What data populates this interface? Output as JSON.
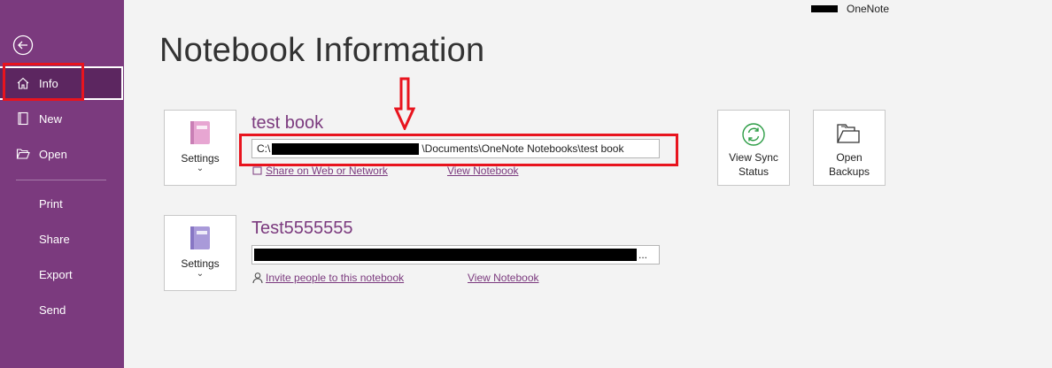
{
  "app": {
    "name": "OneNote"
  },
  "sidebar": {
    "back_icon": "back-arrow-icon",
    "items": [
      {
        "label": "Info",
        "icon": "home-icon"
      },
      {
        "label": "New",
        "icon": "new-notebook-icon"
      },
      {
        "label": "Open",
        "icon": "folder-open-icon"
      },
      {
        "label": "Print"
      },
      {
        "label": "Share"
      },
      {
        "label": "Export"
      },
      {
        "label": "Send"
      }
    ]
  },
  "page": {
    "title": "Notebook Information"
  },
  "notebooks": [
    {
      "name": "test book",
      "settings_label": "Settings",
      "path_prefix": "C:\\",
      "path_suffix": "\\Documents\\OneNote Notebooks\\test book",
      "share_link": "Share on Web or Network",
      "view_link": "View Notebook"
    },
    {
      "name": "Test5555555",
      "settings_label": "Settings",
      "path_suffix": "...",
      "share_link": "Invite people to this notebook",
      "view_link": "View Notebook"
    }
  ],
  "actions": {
    "sync_label_1": "View Sync",
    "sync_label_2": "Status",
    "backups_label_1": "Open",
    "backups_label_2": "Backups"
  },
  "colors": {
    "sidebar": "#7b3a7e",
    "accent": "#7b3a7e",
    "annotation": "#e8141e"
  }
}
